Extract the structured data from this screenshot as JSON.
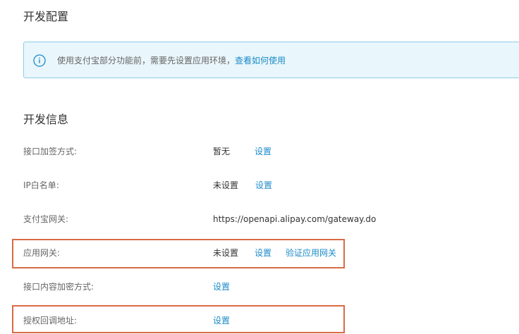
{
  "dev_config": {
    "title": "开发配置",
    "notice": {
      "icon": "info-icon",
      "text": "使用支付宝部分功能前，需要先设置应用环境，",
      "link": "查看如何使用"
    }
  },
  "dev_info": {
    "title": "开发信息",
    "rows": [
      {
        "label": "接口加签方式:",
        "value": "暂无",
        "action": "设置"
      },
      {
        "label": "IP白名单:",
        "value": "未设置",
        "action": "设置"
      },
      {
        "label": "支付宝网关:",
        "value": "https://openapi.alipay.com/gateway.do"
      },
      {
        "label": "应用网关:",
        "value": "未设置",
        "action": "设置",
        "action2": "验证应用网关"
      },
      {
        "label": "接口内容加密方式:",
        "action": "设置"
      },
      {
        "label": "授权回调地址:",
        "action": "设置"
      }
    ]
  },
  "colors": {
    "link": "#1b8bc9",
    "highlight": "#d96a46",
    "notice_bg": "#e9f6fb",
    "notice_border": "#8ecde7"
  }
}
